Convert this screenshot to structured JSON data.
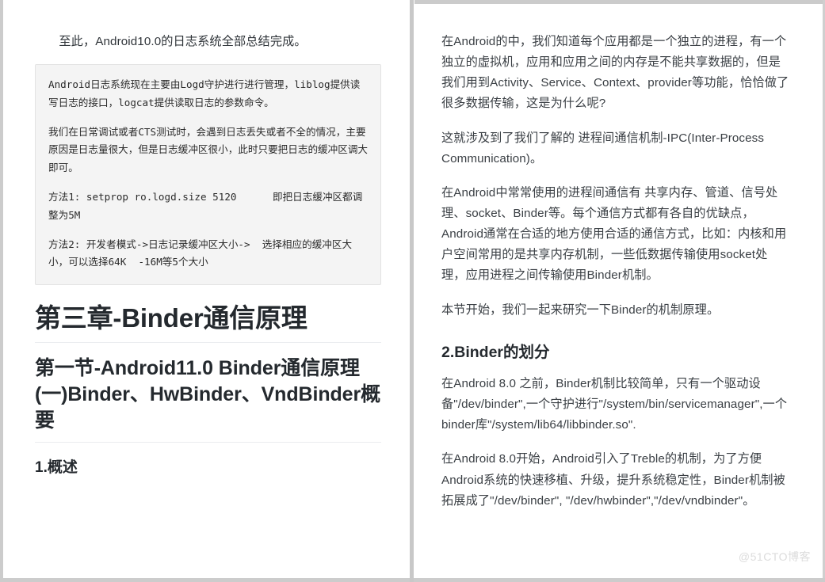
{
  "document": {
    "watermark": "@51CTO博客"
  },
  "left_column": {
    "intro_paragraph": "至此，Android10.0的日志系统全部总结完成。",
    "code_block": {
      "lines": [
        "Android日志系统现在主要由Logd守护进行进行管理，liblog提供读写日志的接口，logcat提供读取日志的参数命令。",
        "我们在日常调试或者CTS测试时，会遇到日志丢失或者不全的情况，主要原因是日志量很大，但是日志缓冲区很小，此时只要把日志的缓冲区调大即可。",
        "方法1: setprop ro.logd.size 5120      即把日志缓冲区都调整为5M",
        "方法2: 开发者模式->日志记录缓冲区大小->  选择相应的缓冲区大小，可以选择64K  -16M等5个大小"
      ]
    },
    "heading_1": "第三章-Binder通信原理",
    "heading_2": "第一节-Android11.0 Binder通信原理(一)Binder、HwBinder、VndBinder概要",
    "heading_3": "1.概述"
  },
  "right_column": {
    "paragraph_1": "在Android的中，我们知道每个应用都是一个独立的进程，有一个独立的虚拟机，应用和应用之间的内存是不能共享数据的，但是我们用到Activity、Service、Context、provider等功能，恰恰做了很多数据传输，这是为什么呢?",
    "paragraph_2": "这就涉及到了我们了解的 进程间通信机制-IPC(Inter-Process Communication)。",
    "paragraph_3": "在Android中常常使用的进程间通信有 共享内存、管道、信号处理、socket、Binder等。每个通信方式都有各自的优缺点，Android通常在合适的地方使用合适的通信方式，比如：内核和用户空间常用的是共享内存机制，一些低数据传输使用socket处理，应用进程之间传输使用Binder机制。",
    "paragraph_4": "本节开始，我们一起来研究一下Binder的机制原理。",
    "heading_1": "2.Binder的划分",
    "paragraph_5": "在Android 8.0 之前，Binder机制比较简单，只有一个驱动设备\"/dev/binder\",一个守护进行\"/system/bin/servicemanager\",一个binder库\"/system/lib64/libbinder.so\".",
    "paragraph_6": "在Android 8.0开始，Android引入了Treble的机制，为了方便Android系统的快速移植、升级，提升系统稳定性，Binder机制被拓展成了\"/dev/binder\", \"/dev/hwbinder\",\"/dev/vndbinder\"。"
  }
}
